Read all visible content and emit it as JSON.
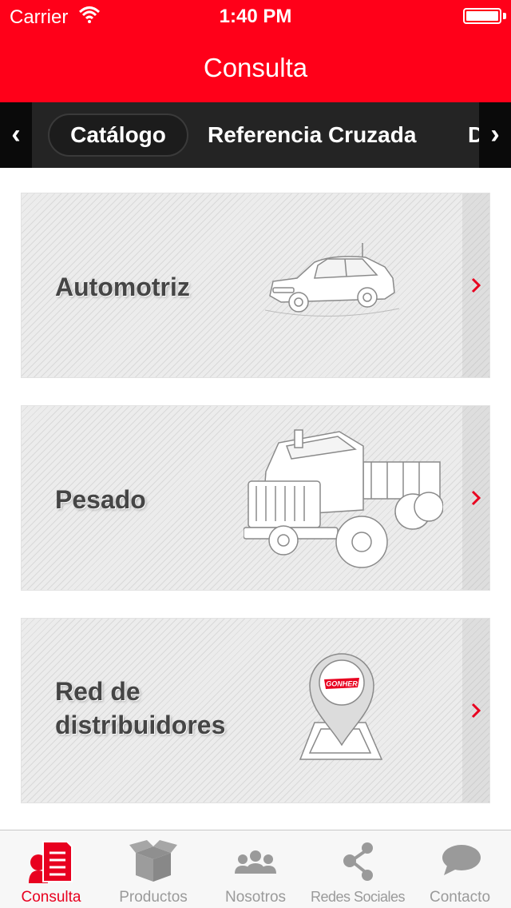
{
  "status_bar": {
    "carrier": "Carrier",
    "time": "1:40 PM",
    "battery_level": 1.0
  },
  "nav": {
    "title": "Consulta"
  },
  "segments": {
    "left_arrow": "‹",
    "right_arrow": "›",
    "items": [
      {
        "label": "Catálogo",
        "selected": true
      },
      {
        "label": "Referencia Cruzada",
        "selected": false
      },
      {
        "label": "D",
        "selected": false
      }
    ]
  },
  "cards": [
    {
      "label": "Automotriz",
      "art": "car-illustration"
    },
    {
      "label": "Pesado",
      "art": "truck-illustration"
    },
    {
      "label_line1": "Red de",
      "label_line2": "distribuidores",
      "art": "map-pin-illustration",
      "logo_text": "GONHER"
    }
  ],
  "tabbar": {
    "tabs": [
      {
        "label": "Consulta",
        "icon": "document-icon",
        "active": true
      },
      {
        "label": "Productos",
        "icon": "box-icon",
        "active": false
      },
      {
        "label": "Nosotros",
        "icon": "people-icon",
        "active": false
      },
      {
        "label": "Redes Sociales",
        "icon": "share-icon",
        "active": false
      },
      {
        "label": "Contacto",
        "icon": "speech-bubble-icon",
        "active": false
      }
    ]
  },
  "colors": {
    "brand_red": "#ff0019",
    "segment_bg": "#242424",
    "tab_inactive": "#9a9a9a",
    "tab_active": "#e8001f"
  }
}
